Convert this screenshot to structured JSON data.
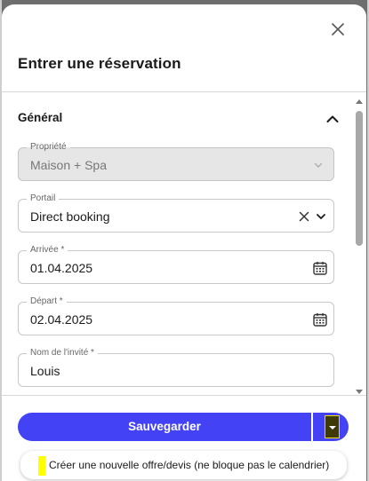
{
  "modal": {
    "title": "Entrer une réservation"
  },
  "section": {
    "title": "Général"
  },
  "fields": {
    "property": {
      "label": "Propriété",
      "value": "Maison + Spa"
    },
    "portal": {
      "label": "Portail",
      "value": "Direct booking"
    },
    "arrival": {
      "label": "Arrivée *",
      "value": "01.04.2025"
    },
    "departure": {
      "label": "Départ *",
      "value": "02.04.2025"
    },
    "guest_name": {
      "label": "Nom de l'invité *",
      "value": "Louis"
    }
  },
  "footer": {
    "save_label": "Sauvegarder",
    "dropdown_option": "Créer une nouvelle offre/devis (ne bloque pas le calendrier)"
  },
  "icons": {
    "close": "close-icon",
    "collapse": "chevron-up-icon",
    "clear": "clear-icon",
    "chevron": "chevron-down-icon",
    "calendar": "calendar-icon",
    "split": "caret-down-icon"
  },
  "colors": {
    "primary": "#4343f5",
    "highlight": "#ffff00",
    "split_toggle_bg": "#3e3a08"
  }
}
